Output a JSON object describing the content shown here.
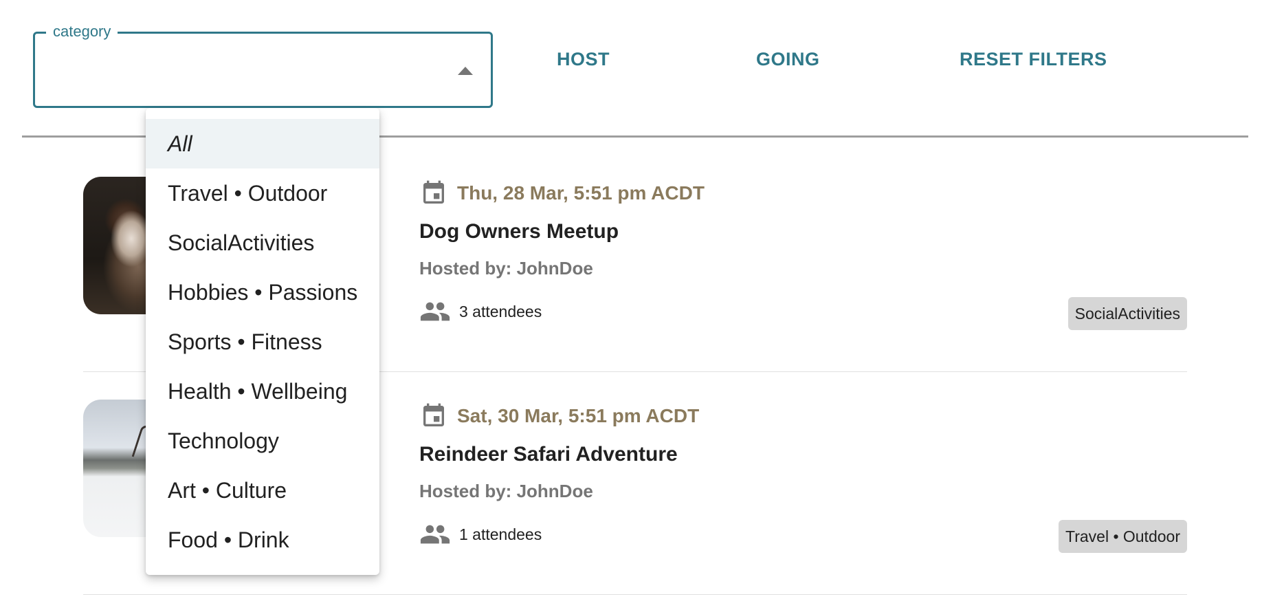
{
  "filters": {
    "category_label": "category",
    "category_value": "",
    "host_label": "HOST",
    "going_label": "GOING",
    "reset_label": "RESET FILTERS"
  },
  "category_menu": {
    "items": [
      {
        "label": "All",
        "selected": true
      },
      {
        "label": "Travel • Outdoor"
      },
      {
        "label": "SocialActivities"
      },
      {
        "label": "Hobbies • Passions"
      },
      {
        "label": "Sports • Fitness"
      },
      {
        "label": "Health • Wellbeing"
      },
      {
        "label": "Technology"
      },
      {
        "label": "Art • Culture"
      },
      {
        "label": "Food • Drink"
      }
    ]
  },
  "events": [
    {
      "date": "Thu, 28 Mar, 5:51 pm ACDT",
      "title": "Dog Owners Meetup",
      "host": "Hosted by: JohnDoe",
      "attendees": "3 attendees",
      "category": "SocialActivities",
      "image": "dog photo"
    },
    {
      "date": "Sat, 30 Mar, 5:51 pm ACDT",
      "title": "Reindeer Safari Adventure",
      "host": "Hosted by: JohnDoe",
      "attendees": "1 attendees",
      "category": "Travel • Outdoor",
      "image": "reindeer photo"
    }
  ],
  "colors": {
    "accent": "#2f7889",
    "date": "#8a7a5c",
    "chip_bg": "#d6d6d6"
  },
  "icons": {
    "calendar": "calendar-icon",
    "people": "people-icon",
    "dropdown": "arrow-up-icon"
  }
}
